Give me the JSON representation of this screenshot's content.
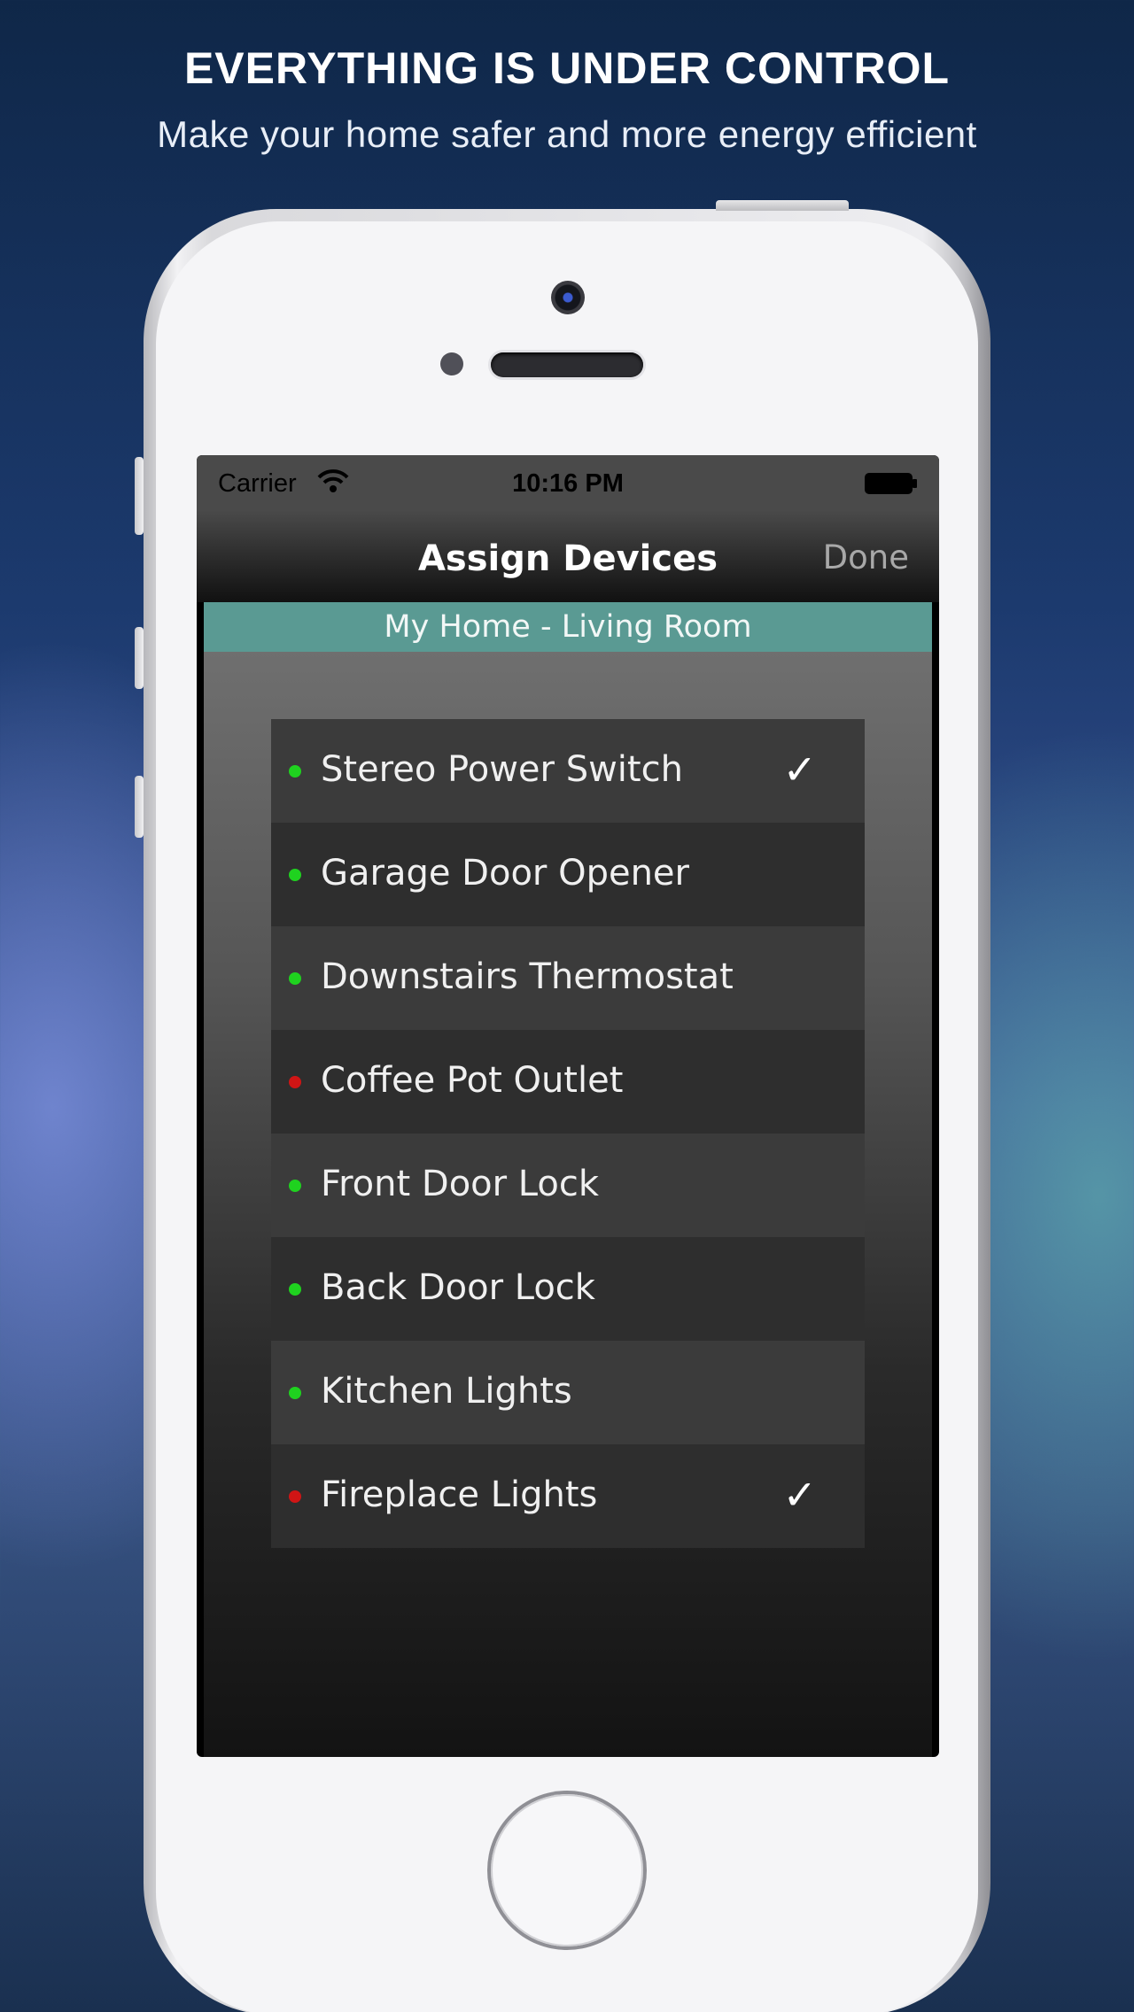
{
  "promo": {
    "headline": "EVERYTHING IS UNDER CONTROL",
    "subline": "Make your home safer and more energy efficient"
  },
  "status_bar": {
    "carrier": "Carrier",
    "time": "10:16 PM"
  },
  "nav": {
    "title": "Assign Devices",
    "done_label": "Done"
  },
  "room": {
    "label": "My Home - Living Room"
  },
  "colors": {
    "online": "#1fd21f",
    "offline": "#d01515",
    "banner": "#5a9a93"
  },
  "devices": [
    {
      "name": "Stereo Power Switch",
      "status": "online",
      "selected": true,
      "check": "✓"
    },
    {
      "name": "Garage Door Opener",
      "status": "online",
      "selected": false,
      "check": ""
    },
    {
      "name": "Downstairs Thermostat",
      "status": "online",
      "selected": false,
      "check": ""
    },
    {
      "name": "Coffee Pot Outlet",
      "status": "offline",
      "selected": false,
      "check": ""
    },
    {
      "name": "Front Door Lock",
      "status": "online",
      "selected": false,
      "check": ""
    },
    {
      "name": "Back Door Lock",
      "status": "online",
      "selected": false,
      "check": ""
    },
    {
      "name": "Kitchen Lights",
      "status": "online",
      "selected": false,
      "check": ""
    },
    {
      "name": "Fireplace Lights",
      "status": "offline",
      "selected": true,
      "check": "✓"
    }
  ]
}
